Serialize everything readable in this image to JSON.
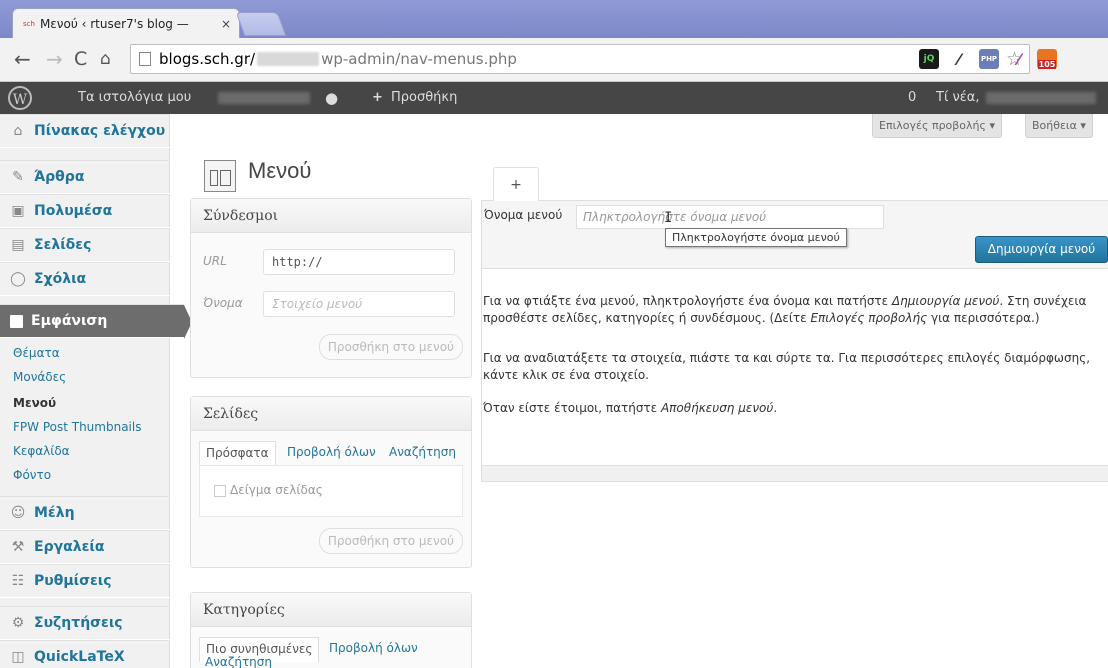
{
  "browser": {
    "tab_title": "Μενού ‹ rtuser7's blog — ",
    "tab_favicon": "sch",
    "tab_close": "×",
    "url_host": "blogs.sch.gr/",
    "url_path": "wp-admin/nav-menus.php",
    "extensions": [
      {
        "name": "jquery-ext",
        "label": "jQ",
        "color": "#1a1a1a"
      },
      {
        "name": "eyedropper-ext",
        "label": "",
        "color": "#333"
      },
      {
        "name": "php-ext",
        "label": "PHP",
        "color": "#6c7eb7"
      },
      {
        "name": "pen-ext",
        "label": "",
        "color": "#a64ca6"
      },
      {
        "name": "rss-ext",
        "label": "105",
        "color": "#e8741f"
      }
    ]
  },
  "adminbar": {
    "my_blogs": "Τα ιστολόγια μου",
    "new_label": "Προσθήκη",
    "count": "0",
    "howdy": "Τί νέα,"
  },
  "sidebar": {
    "items": [
      {
        "label": "Πίνακας ελέγχου",
        "icon": "home-icon"
      },
      {
        "label": "Άρθρα",
        "icon": "pin-icon"
      },
      {
        "label": "Πολυμέσα",
        "icon": "media-icon"
      },
      {
        "label": "Σελίδες",
        "icon": "pages-icon"
      },
      {
        "label": "Σχόλια",
        "icon": "comments-icon"
      },
      {
        "label": "Εμφάνιση",
        "icon": "appearance-icon"
      },
      {
        "label": "Μέλη",
        "icon": "users-icon"
      },
      {
        "label": "Εργαλεία",
        "icon": "tools-icon"
      },
      {
        "label": "Ρυθμίσεις",
        "icon": "settings-icon"
      },
      {
        "label": "Συζητήσεις",
        "icon": "gear-icon"
      },
      {
        "label": "QuickLaTeX",
        "icon": "latex-icon"
      }
    ],
    "submenu": [
      "Θέματα",
      "Μονάδες",
      "Μενού",
      "FPW Post Thumbnails",
      "Κεφαλίδα",
      "Φόντο"
    ]
  },
  "screen_options": "Επιλογές προβολής ▾",
  "help": "Βοήθεια ▾",
  "page_title": "Μενού",
  "links_box": {
    "title": "Σύνδεσμοι",
    "url_label": "URL",
    "url_value": "http://",
    "name_label": "Όνομα",
    "name_placeholder": "Στοιχείο μενού",
    "add_button": "Προσθήκη στο μενού"
  },
  "pages_box": {
    "title": "Σελίδες",
    "tabs": [
      "Πρόσφατα",
      "Προβολή όλων",
      "Αναζήτηση"
    ],
    "sample_page": "Δείγμα σελίδας",
    "add_button": "Προσθήκη στο μενού"
  },
  "categories_box": {
    "title": "Κατηγορίες",
    "tabs": [
      "Πιο συνηθισμένες",
      "Προβολή όλων",
      "Αναζήτηση"
    ]
  },
  "menu_editor": {
    "plus_tab": "+",
    "name_label": "Όνομα μενού",
    "name_placeholder": "Πληκτρολογήστε όνομα μενού",
    "tooltip": "Πληκτρολογήστε όνομα μενού",
    "create_button": "Δημιουργία μενού",
    "help_1a": "Για να φτιάξτε ένα μενού, πληκτρολογήστε ένα όνομα και πατήστε ",
    "help_1b": "Δημιουργία μενού",
    "help_1c": ". Στη συνέχεια προσθέστε σελίδες, κατηγορίες ή συνδέσμους. (Δείτε ",
    "help_1d": "Επιλογές προβολής",
    "help_1e": " για περισσότερα.)",
    "help_2": "Για να αναδιατάξετε τα στοιχεία, πιάστε τα και σύρτε τα. Για περισσότερες επιλογές διαμόρφωσης, κάντε κλικ σε ένα στοιχείο.",
    "help_3a": "Όταν είστε έτοιμοι, πατήστε ",
    "help_3b": "Αποθήκευση μενού",
    "help_3c": "."
  }
}
